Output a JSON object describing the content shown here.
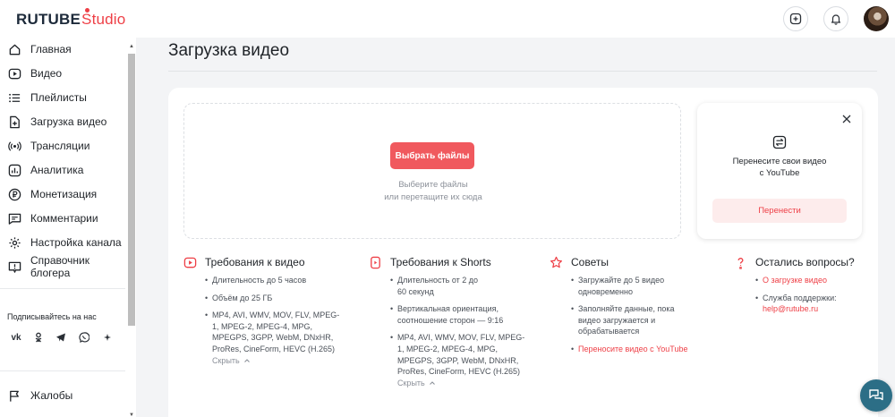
{
  "header": {
    "logo_brand": "RUTUBE",
    "logo_studio": "Studio"
  },
  "sidebar": {
    "items": [
      {
        "label": "Главная",
        "icon": "home-icon"
      },
      {
        "label": "Видео",
        "icon": "play-icon"
      },
      {
        "label": "Плейлисты",
        "icon": "list-icon"
      },
      {
        "label": "Загрузка видео",
        "icon": "upload-file-icon"
      },
      {
        "label": "Трансляции",
        "icon": "broadcast-icon"
      },
      {
        "label": "Аналитика",
        "icon": "analytics-icon"
      },
      {
        "label": "Монетизация",
        "icon": "ruble-icon"
      },
      {
        "label": "Комментарии",
        "icon": "comment-icon"
      },
      {
        "label": "Настройка канала",
        "icon": "gear-icon"
      },
      {
        "label": "Справочник блогера",
        "icon": "info-icon"
      }
    ],
    "subscribe_title": "Подписывайтесь на нас",
    "socials": [
      "vk-icon",
      "ok-icon",
      "telegram-icon",
      "viber-icon",
      "more-icon"
    ],
    "bottom_items": [
      {
        "label": "Жалобы",
        "icon": "flag-icon"
      }
    ]
  },
  "main": {
    "title": "Загрузка видео",
    "dropzone": {
      "button_label": "Выбрать файлы",
      "hint_line1": "Выберите файлы",
      "hint_line2": "или перетащите их сюда"
    },
    "youtube_card": {
      "text_line1": "Перенесите свои видео",
      "text_line2": "с YouTube",
      "button_label": "Перенести"
    },
    "columns": [
      {
        "title": "Требования к видео",
        "items": [
          "Длительность до 5 часов",
          "Объём до 25 ГБ",
          "MP4, AVI, WMV, MOV, FLV, MPEG-1, MPEG-2, MPEG-4, MPG, MPEGPS, 3GPP, WebM, DNxHR, ProRes, CineForm, HEVC (H.265)"
        ],
        "collapse_label": "Скрыть"
      },
      {
        "title": "Требования к Shorts",
        "items": [
          "Длительность от 2 до 60 секунд",
          "Вертикальная ориентация, соотношение сторон — 9:16",
          "MP4, AVI, WMV, MOV, FLV, MPEG-1, MPEG-2, MPEG-4, MPG, MPEGPS, 3GPP, WebM, DNxHR, ProRes, CineForm, HEVC (H.265)"
        ],
        "collapse_label": "Скрыть"
      },
      {
        "title": "Советы",
        "items": [
          "Загружайте до 5 видео одновременно",
          "Заполняйте данные, пока видео загружается и обрабатывается",
          "Переносите видео с YouTube"
        ]
      },
      {
        "title": "Остались вопросы?",
        "items": [
          "О загрузке видео",
          "Служба поддержки:"
        ],
        "support_email": "help@rutube.ru"
      }
    ]
  },
  "colors": {
    "accent": "#f0595e",
    "accent_text": "#ee3f46",
    "accent_soft": "#fdecec",
    "chat_fab": "#2c6e86"
  }
}
